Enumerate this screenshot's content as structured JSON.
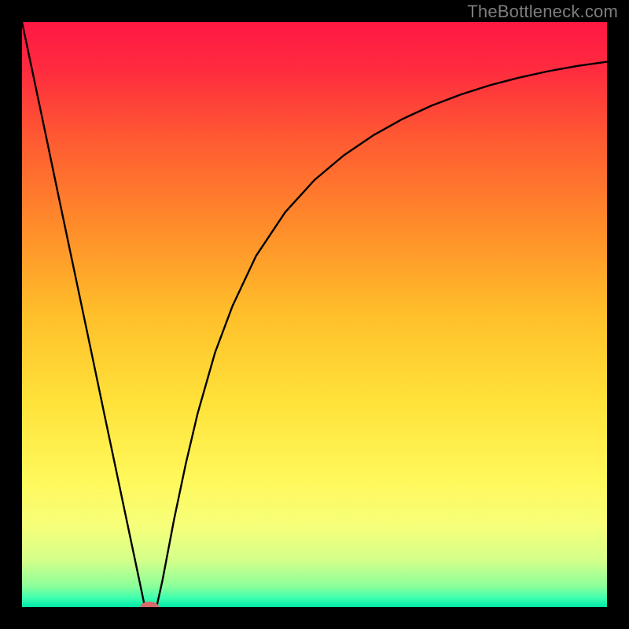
{
  "watermark": "TheBottleneck.com",
  "chart_data": {
    "type": "line",
    "title": "",
    "xlabel": "",
    "ylabel": "",
    "xlim": [
      0,
      100
    ],
    "ylim": [
      0,
      100
    ],
    "gradient_stops": [
      {
        "offset": 0.0,
        "color": "#ff1744"
      },
      {
        "offset": 0.08,
        "color": "#ff2b3f"
      },
      {
        "offset": 0.2,
        "color": "#ff5a32"
      },
      {
        "offset": 0.35,
        "color": "#ff8c2a"
      },
      {
        "offset": 0.5,
        "color": "#ffbf2a"
      },
      {
        "offset": 0.65,
        "color": "#ffe23a"
      },
      {
        "offset": 0.78,
        "color": "#fff85a"
      },
      {
        "offset": 0.86,
        "color": "#f7ff79"
      },
      {
        "offset": 0.92,
        "color": "#d4ff8a"
      },
      {
        "offset": 0.965,
        "color": "#8aff9a"
      },
      {
        "offset": 0.985,
        "color": "#3dffb0"
      },
      {
        "offset": 1.0,
        "color": "#00e8a8"
      }
    ],
    "series": [
      {
        "name": "bottleneck-curve",
        "x": [
          0,
          2,
          4,
          6,
          8,
          10,
          12,
          14,
          16,
          18,
          20,
          21,
          22,
          23,
          24,
          26,
          28,
          30,
          33,
          36,
          40,
          45,
          50,
          55,
          60,
          65,
          70,
          75,
          80,
          85,
          90,
          95,
          100
        ],
        "y": [
          100,
          90.5,
          81.0,
          71.4,
          61.9,
          52.4,
          42.9,
          33.3,
          23.8,
          14.3,
          4.8,
          0.0,
          0.0,
          0.0,
          4.5,
          15.0,
          24.5,
          33.0,
          43.5,
          51.5,
          60.0,
          67.5,
          73.0,
          77.2,
          80.6,
          83.4,
          85.7,
          87.6,
          89.2,
          90.5,
          91.6,
          92.5,
          93.2
        ]
      }
    ],
    "marker": {
      "name": "optimal-marker",
      "x_center": 21.8,
      "y": 0,
      "rx": 1.6,
      "ry": 0.9,
      "color": "#d96a6a"
    }
  }
}
